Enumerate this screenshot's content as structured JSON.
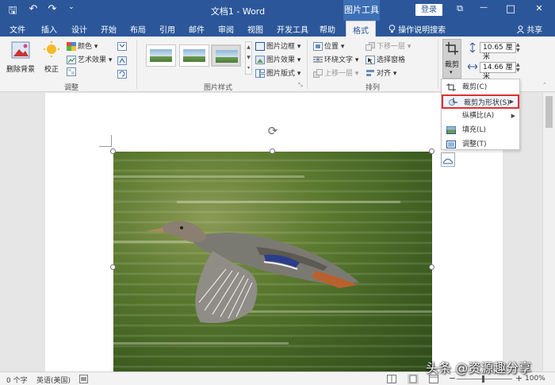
{
  "titlebar": {
    "doc_title": "文档1 - Word",
    "context_tab": "图片工具",
    "login_label": "登录",
    "ribbon_display_glyph": "⧉",
    "minimize_glyph": "—",
    "restore_glyph": "□",
    "close_glyph": "✕",
    "save_glyph": "🖫",
    "undo_glyph": "↶",
    "redo_glyph": "↷",
    "customize_glyph": "⌄"
  },
  "tabs": [
    {
      "label": "文件"
    },
    {
      "label": "插入"
    },
    {
      "label": "设计"
    },
    {
      "label": "开始"
    },
    {
      "label": "布局"
    },
    {
      "label": "引用"
    },
    {
      "label": "邮件"
    },
    {
      "label": "审阅"
    },
    {
      "label": "视图"
    },
    {
      "label": "开发工具"
    },
    {
      "label": "帮助"
    },
    {
      "label": "格式"
    }
  ],
  "tell_me": "操作说明搜索",
  "share": "共享",
  "ribbon": {
    "adjust": {
      "remove_bg": "删除背景",
      "correct": "校正",
      "color": "颜色 ▾",
      "artistic": "艺术效果 ▾",
      "group_label": "调整"
    },
    "styles": {
      "border": "图片边框 ▾",
      "effects": "图片效果 ▾",
      "layout": "图片版式 ▾",
      "group_label": "图片样式"
    },
    "arrange": {
      "position": "位置 ▾",
      "wrap": "环绕文字 ▾",
      "forward": "上移一层 ▾",
      "backward": "下移一层 ▾",
      "selection_pane": "选择窗格",
      "align": "对齐 ▾",
      "group_label": "排列"
    },
    "size": {
      "crop_label": "裁剪",
      "height": "10.65 厘米",
      "width": "14.66 厘米"
    }
  },
  "crop_menu": [
    {
      "label": "裁剪(C)",
      "has_submenu": false,
      "icon": "crop-icon"
    },
    {
      "label": "裁剪为形状(S)",
      "has_submenu": true,
      "icon": "crop-shape-icon"
    },
    {
      "label": "纵横比(A)",
      "has_submenu": true,
      "icon": ""
    },
    {
      "label": "填充(L)",
      "has_submenu": false,
      "icon": "fill-icon"
    },
    {
      "label": "调整(T)",
      "has_submenu": false,
      "icon": "fit-icon"
    }
  ],
  "statusbar": {
    "word_count": "0 个字",
    "language": "英语(美国)",
    "zoom": "100%",
    "zoom_minus": "−",
    "zoom_plus": "+"
  },
  "watermark": "头条 @资源趣分享",
  "colors": {
    "word_blue": "#2b579a",
    "highlight_red": "#e0302f"
  }
}
